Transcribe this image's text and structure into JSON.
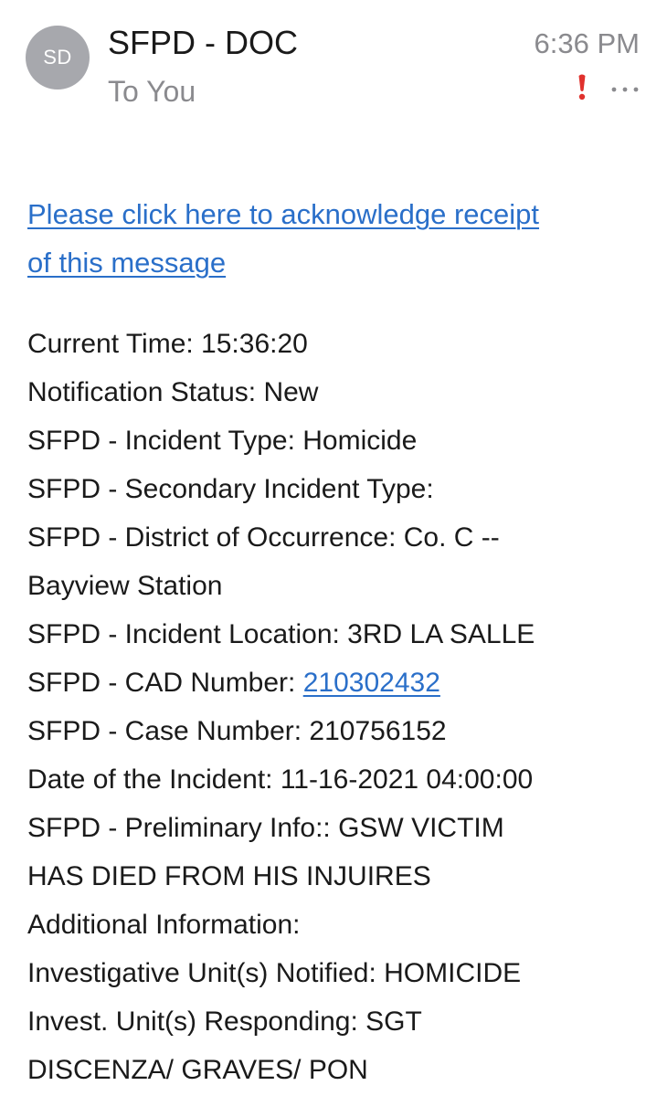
{
  "header": {
    "avatar_initials": "SD",
    "sender": "SFPD - DOC",
    "recipient": "To You",
    "time": "6:36 PM",
    "priority_icon": "exclamation-icon",
    "priority_color": "#e0312d",
    "more_icon": "ellipsis-icon"
  },
  "body": {
    "ack_link_line1": "Please click here to acknowledge receipt",
    "ack_link_line2": "of this message",
    "link_color": "#2a6fc9",
    "fields": {
      "current_time": "Current Time: 15:36:20",
      "notification_status": "Notification Status: New",
      "incident_type": "SFPD - Incident Type: Homicide",
      "secondary_incident_type": "SFPD - Secondary Incident Type:",
      "district_line1": "SFPD - District of Occurrence: Co. C --",
      "district_line2": "Bayview Station",
      "incident_location": "SFPD - Incident Location: 3RD LA SALLE",
      "cad_label": "SFPD - CAD Number: ",
      "cad_number": "210302432",
      "case_number": "SFPD - Case Number: 210756152",
      "incident_date": "Date of the Incident: 11-16-2021 04:00:00",
      "preliminary_line1": "SFPD - Preliminary Info:: GSW VICTIM",
      "preliminary_line2": "HAS DIED FROM HIS INJUIRES",
      "additional_info": "Additional Information:",
      "units_notified": "Investigative Unit(s) Notified: HOMICIDE",
      "responding_line1": "Invest. Unit(s) Responding: SGT",
      "responding_line2": "DISCENZA/ GRAVES/ PON"
    }
  }
}
